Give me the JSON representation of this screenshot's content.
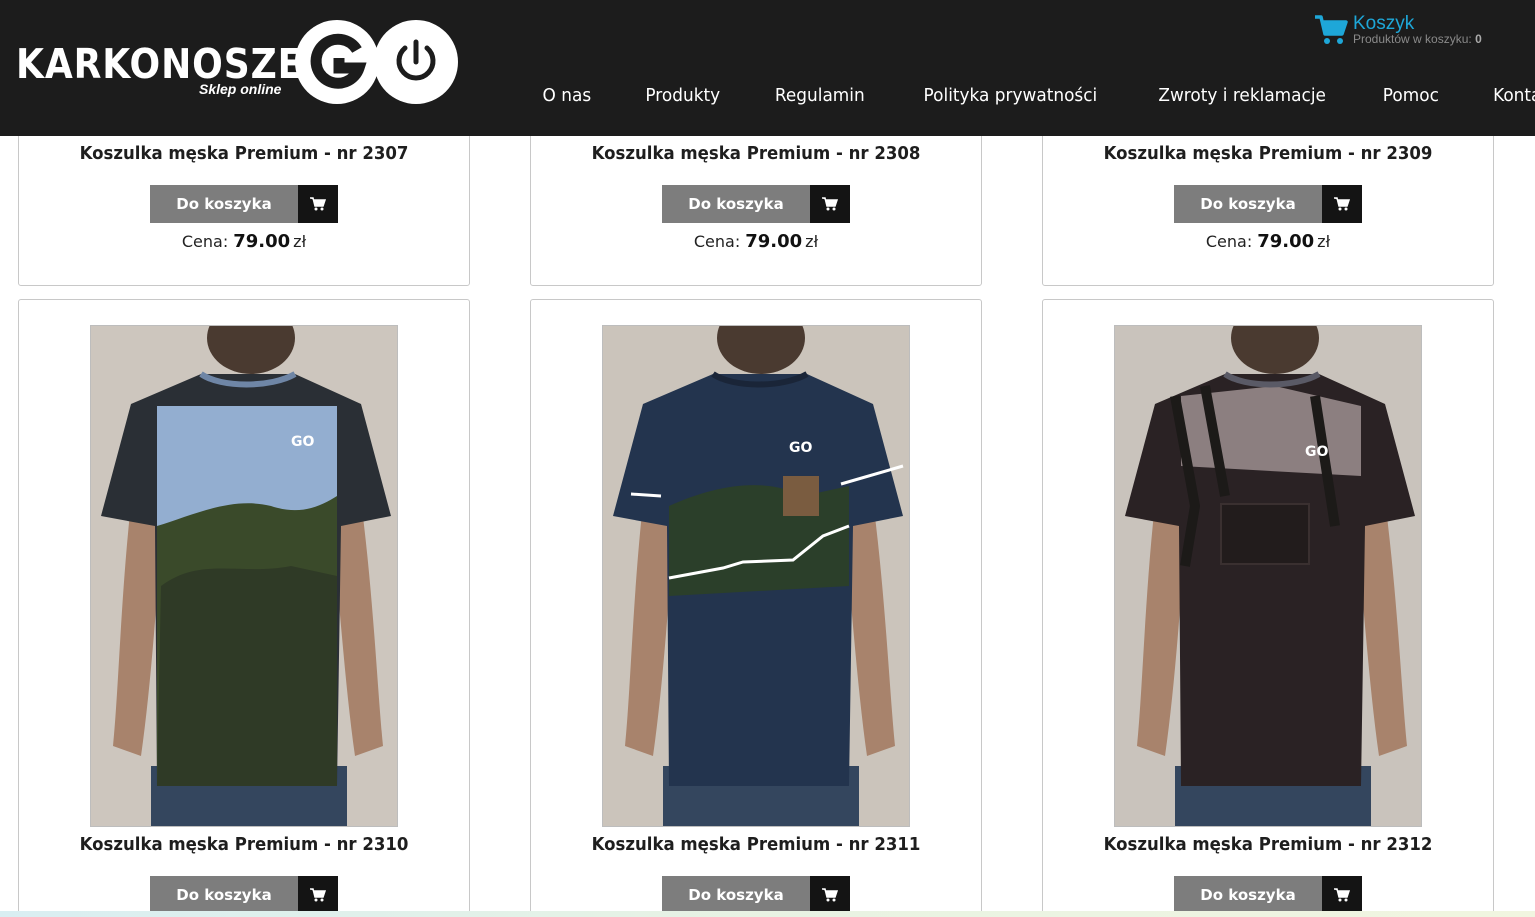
{
  "header": {
    "logo": {
      "main": "KARKONOSZE",
      "sub": "Sklep online",
      "go": "GO"
    },
    "cart": {
      "title": "Koszyk",
      "count_label": "Produktów w koszyku:",
      "count": "0",
      "accent": "#1ea7d8"
    },
    "nav": [
      "O nas",
      "Produkty",
      "Regulamin",
      "Polityka prywatności",
      "Zwroty i reklamacje",
      "Pomoc",
      "Kontakt"
    ]
  },
  "products_top": [
    {
      "name": "Koszulka męska Premium - nr 2307",
      "button": "Do koszyka",
      "price_label": "Cena:",
      "price": "79.00",
      "currency": "zł"
    },
    {
      "name": "Koszulka męska Premium - nr 2308",
      "button": "Do koszyka",
      "price_label": "Cena:",
      "price": "79.00",
      "currency": "zł"
    },
    {
      "name": "Koszulka męska Premium - nr 2309",
      "button": "Do koszyka",
      "price_label": "Cena:",
      "price": "79.00",
      "currency": "zł"
    }
  ],
  "products_bottom": [
    {
      "name": "Koszulka męska Premium - nr 2310",
      "button": "Do koszyka",
      "palette": "sky"
    },
    {
      "name": "Koszulka męska Premium - nr 2311",
      "button": "Do koszyka",
      "palette": "navy"
    },
    {
      "name": "Koszulka męska Premium - nr 2312",
      "button": "Do koszyka",
      "palette": "dark"
    }
  ],
  "colors": {
    "header_bg": "#1c1c1c",
    "button_gray": "#7d7d7d",
    "button_dark": "#141414"
  }
}
